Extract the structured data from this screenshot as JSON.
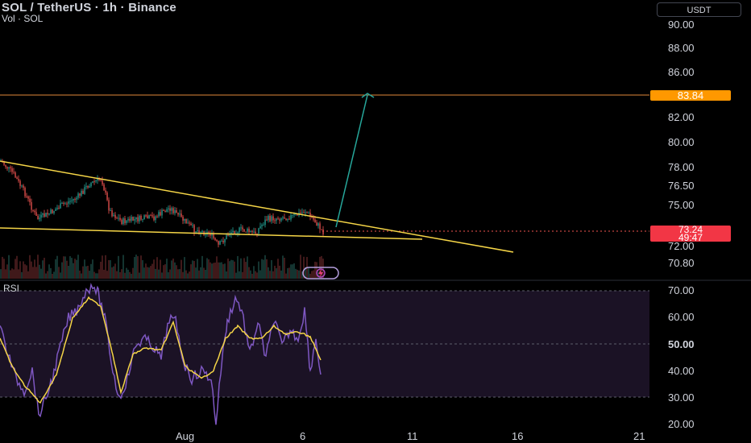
{
  "header": {
    "title": "SOL / TetherUS · 1h · Binance",
    "volume": "Vol · SOL"
  },
  "currency_button": "USDT",
  "price_axis": [
    "90.00",
    "88.00",
    "86.00",
    "82.00",
    "80.00",
    "78.00",
    "76.50",
    "75.00",
    "72.00",
    "70.80"
  ],
  "price_tags": {
    "target": "83.84",
    "last_price": "73.24",
    "countdown": "49:47"
  },
  "rsi_panel": {
    "label": "RSI",
    "axis": [
      "70.00",
      "60.00",
      "50.00",
      "40.00",
      "30.00",
      "20.00"
    ]
  },
  "time_axis": [
    "Aug",
    "6",
    "11",
    "16",
    "21"
  ],
  "colors": {
    "background": "#000000",
    "trendline": "#f5d547",
    "projection": "#26a69a",
    "target_line": "#ff9800",
    "rsi_line": "#7e57c2",
    "rsi_ma": "#f5d547",
    "up": "#26a69a",
    "down": "#ef5350"
  },
  "icons": {
    "logo": "lightning-bolt-icon"
  }
}
